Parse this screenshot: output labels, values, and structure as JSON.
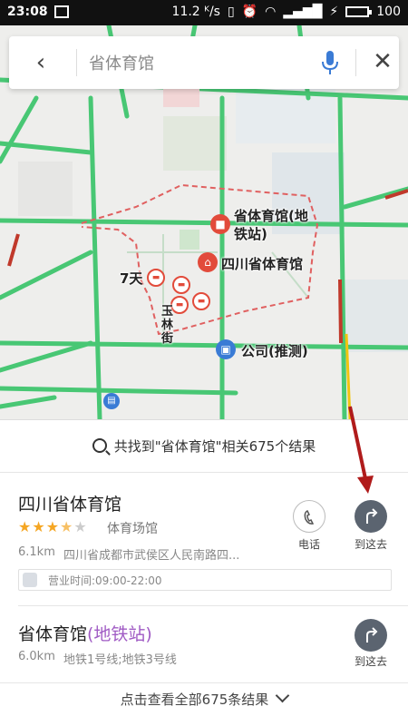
{
  "status_bar": {
    "time": "23:08",
    "network_speed": "11.2 ᴷ/s",
    "battery": "100"
  },
  "search": {
    "query": "省体育馆"
  },
  "map": {
    "labels": {
      "metro_station": "省体育馆(地\n铁站)",
      "stadium": "四川省体育馆",
      "hotel": "7天",
      "street": "玉\n林\n街",
      "company": "公司(推测)"
    }
  },
  "result_summary": "共找到\"省体育馆\"相关675个结果",
  "results": [
    {
      "name": "四川省体育馆",
      "rating_stars": 3.5,
      "category": "体育场馆",
      "distance": "6.1km",
      "address": "四川省成都市武侯区人民南路四...",
      "hours": "营业时间:09:00-22:00",
      "phone_label": "电话",
      "go_label": "到这去"
    },
    {
      "name": "省体育馆",
      "name_suffix": "(地铁站)",
      "distance": "6.0km",
      "lines": "地铁1号线;地铁3号线",
      "go_label": "到这去"
    }
  ],
  "footer": {
    "view_all": "点击查看全部675条结果"
  },
  "colors": {
    "road": "#48c774",
    "pin_red": "#e24b3b",
    "pin_blue": "#3a7bd5",
    "accent_purple": "#a05bc4",
    "arrow": "#b01b1b"
  }
}
